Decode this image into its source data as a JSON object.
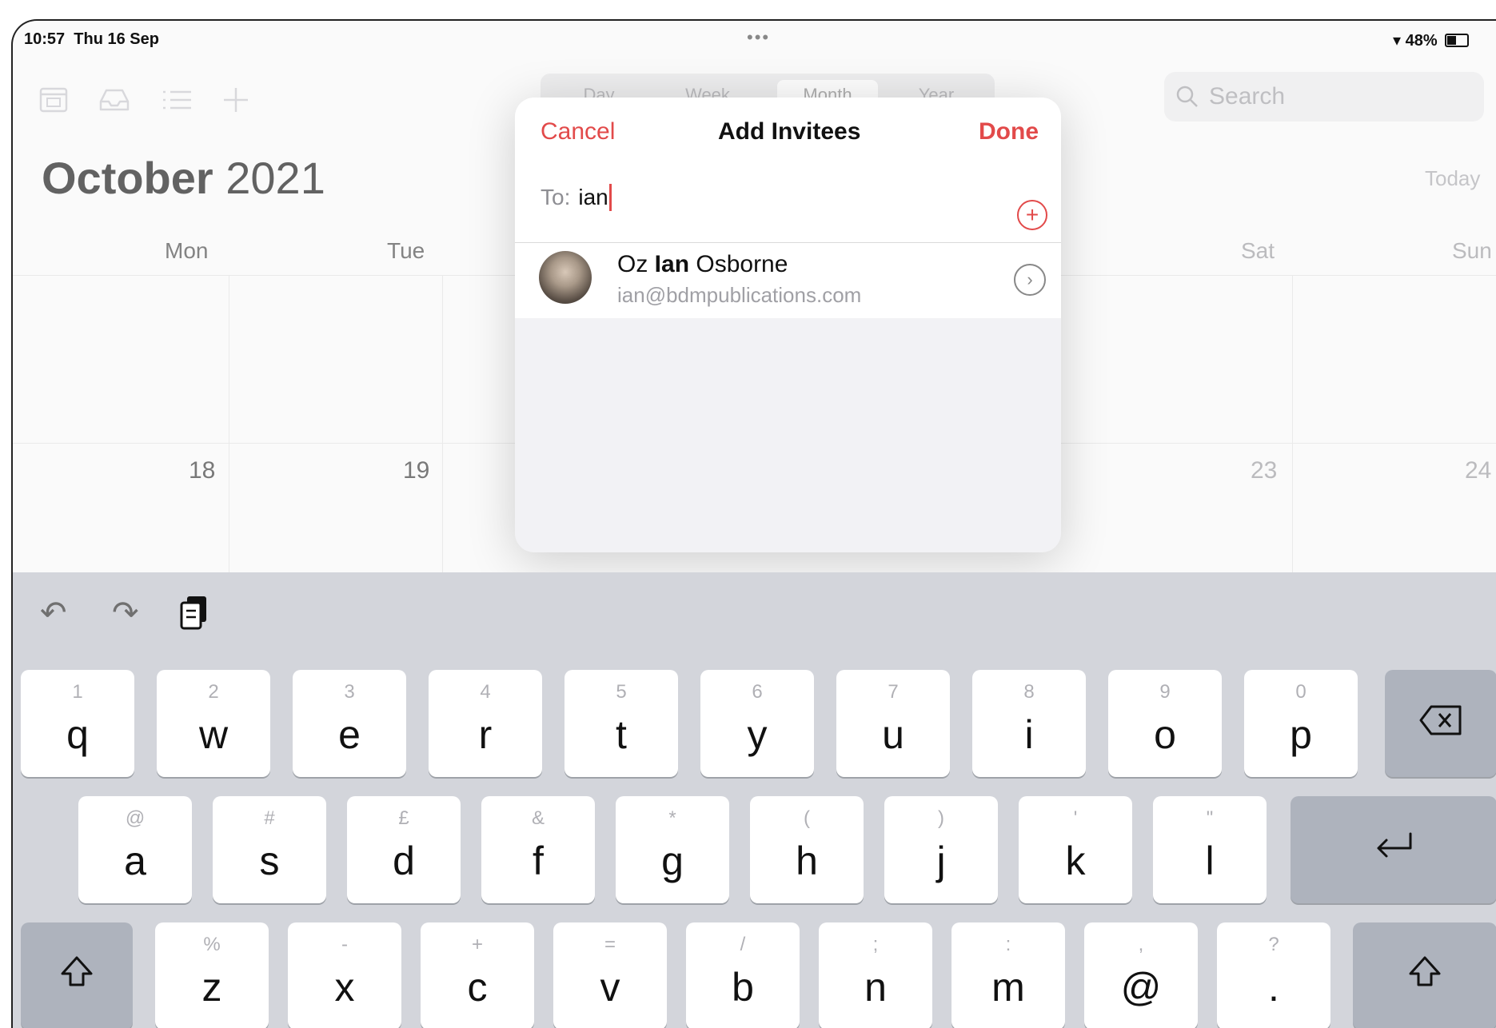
{
  "status_bar": {
    "time": "10:57",
    "date": "Thu 16 Sep",
    "dots": "•••",
    "battery": "48%",
    "wifi_icon": "wifi-icon"
  },
  "toolbar": {
    "icons": [
      "calendars-icon",
      "inbox-icon",
      "list-icon",
      "add-icon"
    ]
  },
  "view_switcher": {
    "options": [
      "Day",
      "Week",
      "Month",
      "Year"
    ],
    "selected": "Month"
  },
  "search": {
    "placeholder": "Search"
  },
  "calendar": {
    "month": "October",
    "year": "2021",
    "today_label": "Today",
    "weekdays": [
      "Mon",
      "Tue",
      "",
      "",
      "",
      "Sat",
      "Sun"
    ],
    "dates": [
      "18",
      "19",
      "23",
      "24"
    ]
  },
  "popover": {
    "cancel": "Cancel",
    "title": "Add Invitees",
    "done": "Done",
    "to_label": "To:",
    "to_value": "ian",
    "result": {
      "name_prefix": "Oz ",
      "name_match": "Ian",
      "name_suffix": " Osborne",
      "email": "ian@bdmpublications.com"
    }
  },
  "keyboard": {
    "row1": [
      [
        "1",
        "q"
      ],
      [
        "2",
        "w"
      ],
      [
        "3",
        "e"
      ],
      [
        "4",
        "r"
      ],
      [
        "5",
        "t"
      ],
      [
        "6",
        "y"
      ],
      [
        "7",
        "u"
      ],
      [
        "8",
        "i"
      ],
      [
        "9",
        "o"
      ],
      [
        "0",
        "p"
      ]
    ],
    "row2": [
      [
        "@",
        "a"
      ],
      [
        "#",
        "s"
      ],
      [
        "£",
        "d"
      ],
      [
        "&",
        "f"
      ],
      [
        "*",
        "g"
      ],
      [
        "(",
        "h"
      ],
      [
        ")",
        "j"
      ],
      [
        "'",
        "k"
      ],
      [
        "\"",
        "l"
      ]
    ],
    "row3": [
      [
        "%",
        "z"
      ],
      [
        "-",
        "x"
      ],
      [
        "+",
        "c"
      ],
      [
        "=",
        "v"
      ],
      [
        "/",
        "b"
      ],
      [
        ";",
        "n"
      ],
      [
        ":",
        "m"
      ],
      [
        ",",
        "@"
      ],
      [
        "?",
        "."
      ]
    ]
  }
}
